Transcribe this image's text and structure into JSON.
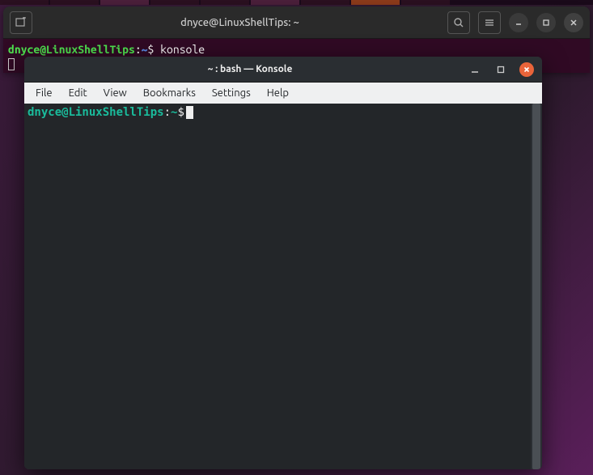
{
  "gnome_terminal": {
    "title": "dnyce@LinuxShellTips: ~",
    "prompt": {
      "user_host": "dnyce@LinuxShellTips",
      "sep": ":",
      "path": "~",
      "symbol": "$"
    },
    "command": "konsole"
  },
  "konsole": {
    "title": "~ : bash — Konsole",
    "menubar": [
      "File",
      "Edit",
      "View",
      "Bookmarks",
      "Settings",
      "Help"
    ],
    "prompt": {
      "user_host": "dnyce@LinuxShellTips",
      "sep": ":",
      "path": "~",
      "symbol": "$"
    }
  }
}
